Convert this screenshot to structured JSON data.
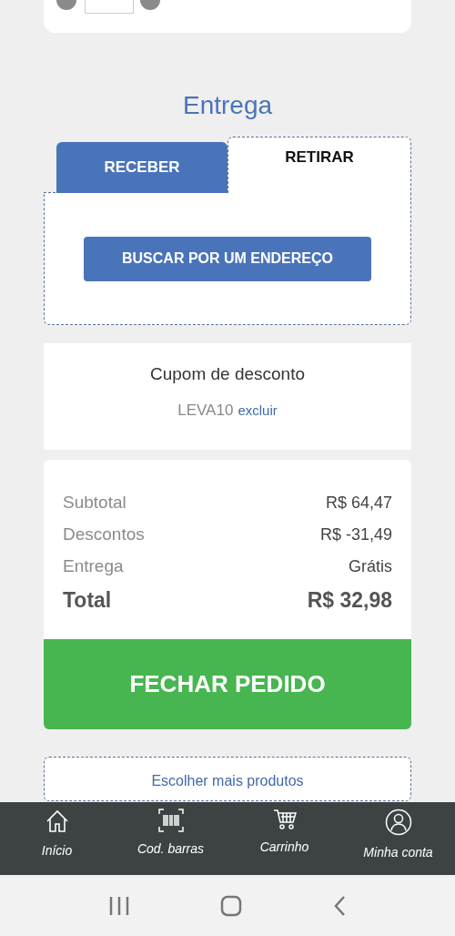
{
  "delivery": {
    "title": "Entrega",
    "tabs": [
      {
        "label": "RECEBER",
        "selected": false
      },
      {
        "label": "RETIRAR",
        "selected": true
      }
    ],
    "search_button": "BUSCAR POR UM ENDEREÇO"
  },
  "coupon": {
    "title": "Cupom de desconto",
    "code": "LEVA10",
    "remove_link": "excluir"
  },
  "summary": {
    "rows": [
      {
        "label": "Subtotal",
        "value": "R$ 64,47",
        "kind": "line"
      },
      {
        "label": "Descontos",
        "value": "R$ -31,49",
        "kind": "line"
      },
      {
        "label": "Entrega",
        "value": "Grátis",
        "kind": "line"
      },
      {
        "label": "Total",
        "value": "R$ 32,98",
        "kind": "total"
      }
    ],
    "checkout_button": "FECHAR PEDIDO"
  },
  "more_products_link": "Escolher mais produtos",
  "bottom_nav": [
    {
      "label": "Início"
    },
    {
      "label": "Cod. barras"
    },
    {
      "label": "Carrinho"
    },
    {
      "label": "Minha conta"
    }
  ]
}
